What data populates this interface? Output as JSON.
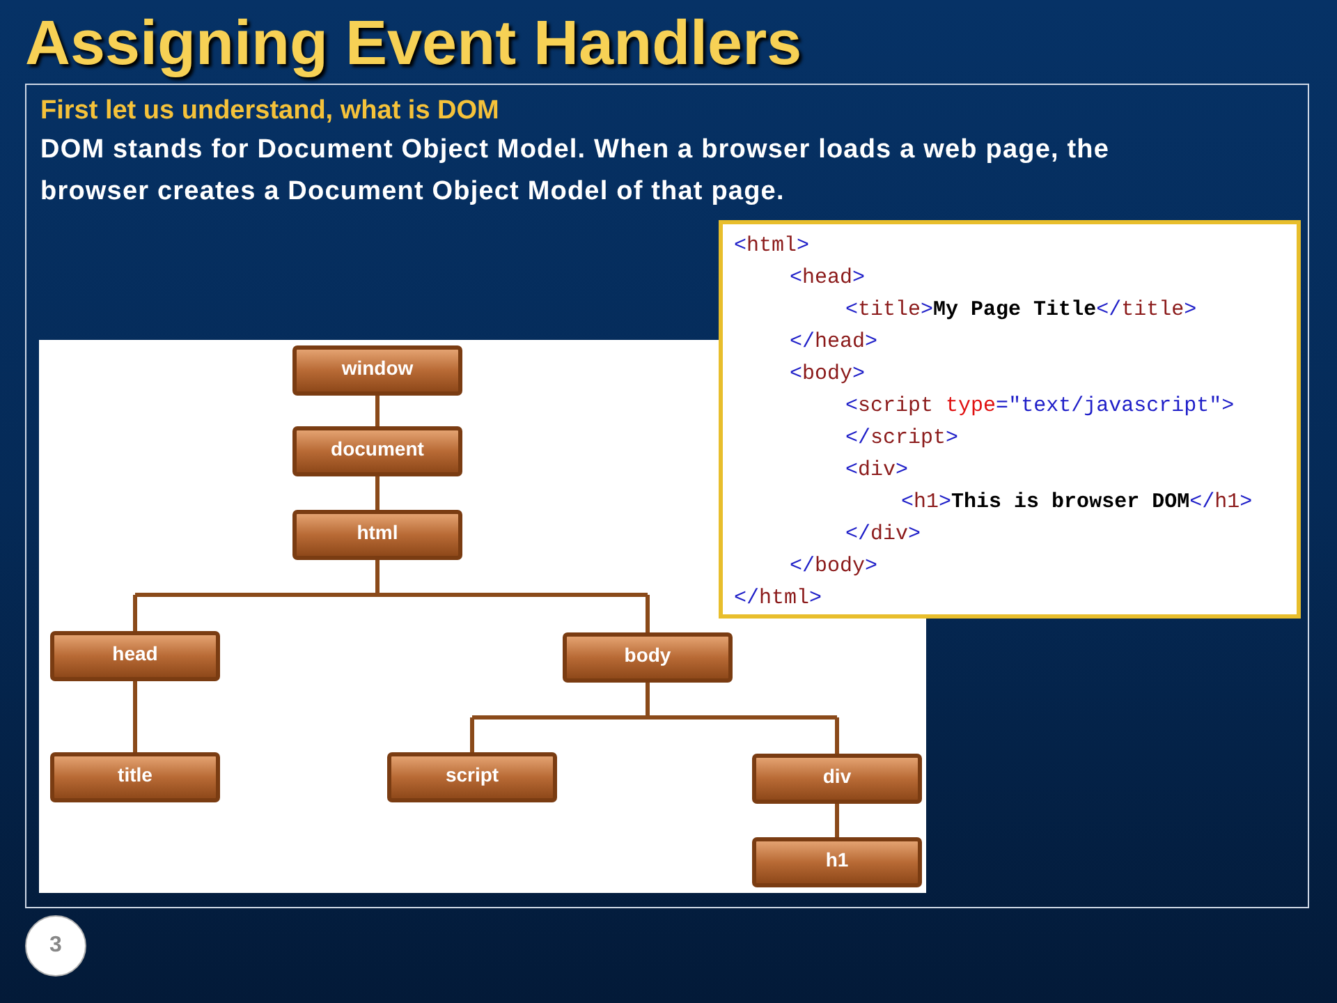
{
  "title": "Assigning Event Handlers",
  "heading": "First let us understand, what is DOM",
  "paragraph": "DOM stands for Document Object Model. When a browser loads a web page, the browser creates a Document Object Model of that page.",
  "code": [
    {
      "tokens": [
        {
          "kind": "punct",
          "text": "<"
        },
        {
          "kind": "tag",
          "text": "html"
        },
        {
          "kind": "punct",
          "text": ">"
        }
      ],
      "children": [
        {
          "tokens": [
            {
              "kind": "punct",
              "text": "<"
            },
            {
              "kind": "tag",
              "text": "head"
            },
            {
              "kind": "punct",
              "text": ">"
            }
          ],
          "children": [
            {
              "tokens": [
                {
                  "kind": "punct",
                  "text": "<"
                },
                {
                  "kind": "tag",
                  "text": "title"
                },
                {
                  "kind": "punct",
                  "text": ">"
                },
                {
                  "kind": "text",
                  "text": "My Page Title"
                },
                {
                  "kind": "punct",
                  "text": "</"
                },
                {
                  "kind": "tag",
                  "text": "title"
                },
                {
                  "kind": "punct",
                  "text": ">"
                }
              ]
            }
          ]
        },
        {
          "tokens": [
            {
              "kind": "punct",
              "text": "</"
            },
            {
              "kind": "tag",
              "text": "head"
            },
            {
              "kind": "punct",
              "text": ">"
            }
          ]
        },
        {
          "tokens": [
            {
              "kind": "punct",
              "text": "<"
            },
            {
              "kind": "tag",
              "text": "body"
            },
            {
              "kind": "punct",
              "text": ">"
            }
          ],
          "children": [
            {
              "tokens": [
                {
                  "kind": "punct",
                  "text": "<"
                },
                {
                  "kind": "tag",
                  "text": "script"
                },
                {
                  "kind": "attr",
                  "text": " type"
                },
                {
                  "kind": "punct",
                  "text": "="
                },
                {
                  "kind": "string",
                  "text": "\"text/javascript\""
                },
                {
                  "kind": "punct",
                  "text": ">"
                }
              ]
            },
            {
              "tokens": [
                {
                  "kind": "punct",
                  "text": "</"
                },
                {
                  "kind": "tag",
                  "text": "script"
                },
                {
                  "kind": "punct",
                  "text": ">"
                }
              ]
            },
            {
              "tokens": [
                {
                  "kind": "punct",
                  "text": "<"
                },
                {
                  "kind": "tag",
                  "text": "div"
                },
                {
                  "kind": "punct",
                  "text": ">"
                }
              ],
              "children": [
                {
                  "tokens": [
                    {
                      "kind": "punct",
                      "text": "<"
                    },
                    {
                      "kind": "tag",
                      "text": "h1"
                    },
                    {
                      "kind": "punct",
                      "text": ">"
                    },
                    {
                      "kind": "text",
                      "text": "This is browser DOM"
                    },
                    {
                      "kind": "punct",
                      "text": "</"
                    },
                    {
                      "kind": "tag",
                      "text": "h1"
                    },
                    {
                      "kind": "punct",
                      "text": ">"
                    }
                  ]
                }
              ]
            },
            {
              "tokens": [
                {
                  "kind": "punct",
                  "text": "</"
                },
                {
                  "kind": "tag",
                  "text": "div"
                },
                {
                  "kind": "punct",
                  "text": ">"
                }
              ]
            }
          ]
        },
        {
          "tokens": [
            {
              "kind": "punct",
              "text": "</"
            },
            {
              "kind": "tag",
              "text": "body"
            },
            {
              "kind": "punct",
              "text": ">"
            }
          ]
        }
      ]
    },
    {
      "tokens": [
        {
          "kind": "punct",
          "text": "</"
        },
        {
          "kind": "tag",
          "text": "html"
        },
        {
          "kind": "punct",
          "text": ">"
        }
      ]
    }
  ],
  "tree": {
    "label": "window",
    "children": [
      {
        "label": "document",
        "children": [
          {
            "label": "html",
            "children": [
              {
                "label": "head",
                "children": [
                  {
                    "label": "title"
                  }
                ]
              },
              {
                "label": "body",
                "children": [
                  {
                    "label": "script"
                  },
                  {
                    "label": "div",
                    "children": [
                      {
                        "label": "h1"
                      }
                    ]
                  }
                ]
              }
            ]
          }
        ]
      }
    ]
  },
  "slide_number": "3"
}
